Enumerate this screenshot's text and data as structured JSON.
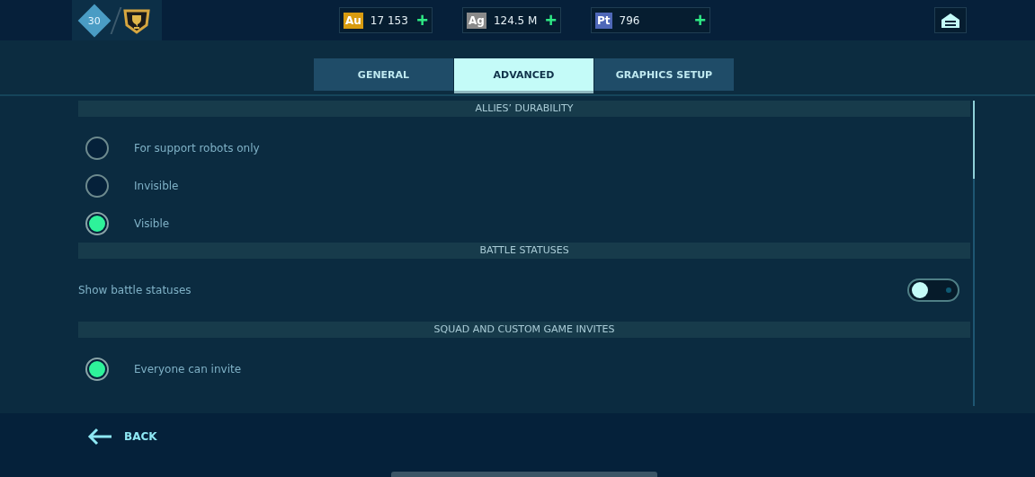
{
  "top_bar": {
    "level": "30",
    "currencies": [
      {
        "kind": "au",
        "symbol": "Au",
        "amount": "17 153",
        "add": "+"
      },
      {
        "kind": "ag",
        "symbol": "Ag",
        "amount": "124.5 M",
        "add": "+"
      },
      {
        "kind": "pt",
        "symbol": "Pt",
        "amount": "796",
        "add": "+"
      }
    ]
  },
  "tabs": [
    {
      "label": "GENERAL",
      "selected": false
    },
    {
      "label": "ADVANCED",
      "selected": true
    },
    {
      "label": "GRAPHICS SETUP",
      "selected": false
    }
  ],
  "sections": [
    {
      "title": "ALLIES’ DURABILITY",
      "items": [
        {
          "kind": "radio",
          "label": "For support robots only",
          "selected": false
        },
        {
          "kind": "radio",
          "label": "Invisible",
          "selected": false
        },
        {
          "kind": "radio",
          "label": "Visible",
          "selected": true
        }
      ]
    },
    {
      "title": "BATTLE STATUSES",
      "items": [
        {
          "kind": "toggle",
          "label": "Show battle statuses",
          "on": false
        }
      ]
    },
    {
      "title": "SQUAD AND CUSTOM GAME INVITES",
      "items": [
        {
          "kind": "radio",
          "label": "Everyone can invite",
          "selected": true
        }
      ]
    }
  ],
  "back": {
    "label": "BACK"
  }
}
